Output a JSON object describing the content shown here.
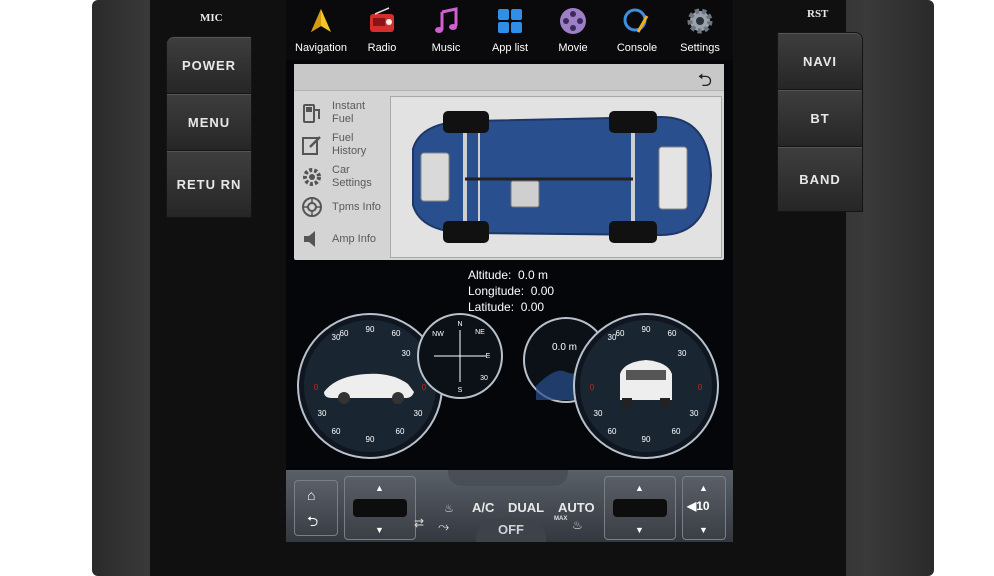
{
  "hardware": {
    "mic_label": "MIC",
    "rst_label": "RST",
    "left_buttons": [
      "POWER",
      "MENU",
      "RETU RN"
    ],
    "right_buttons": [
      "NAVI",
      "BT",
      "BAND"
    ]
  },
  "nav": {
    "items": [
      {
        "label": "Navigation",
        "icon": "navigation-icon"
      },
      {
        "label": "Radio",
        "icon": "radio-icon"
      },
      {
        "label": "Music",
        "icon": "music-icon"
      },
      {
        "label": "App list",
        "icon": "app-list-icon"
      },
      {
        "label": "Movie",
        "icon": "movie-icon"
      },
      {
        "label": "Console",
        "icon": "console-icon"
      },
      {
        "label": "Settings",
        "icon": "settings-icon"
      }
    ]
  },
  "menu": {
    "items": [
      {
        "label1": "Instant",
        "label2": "Fuel",
        "icon": "fuel-pump-icon"
      },
      {
        "label1": "Fuel",
        "label2": "History",
        "icon": "edit-note-icon"
      },
      {
        "label1": "Car",
        "label2": "Settings",
        "icon": "gear-icon"
      },
      {
        "label1": "Tpms Info",
        "label2": "",
        "icon": "tire-icon"
      },
      {
        "label1": "Amp Info",
        "label2": "",
        "icon": "speaker-icon"
      }
    ]
  },
  "location": {
    "altitude_label": "Altitude:",
    "altitude_value": "0.0 m",
    "longitude_label": "Longitude:",
    "longitude_value": "0.00",
    "latitude_label": "Latitude:",
    "latitude_value": "0.00"
  },
  "gauges": {
    "roll_ticks": [
      "30",
      "60",
      "90",
      "60",
      "30",
      "0",
      "0",
      "30",
      "60",
      "90",
      "60",
      "30"
    ],
    "compass": {
      "n": "N",
      "e": "E",
      "s": "S",
      "ne": "NE",
      "nw": "NW",
      "deg": "30"
    },
    "altimeter": "0.0 m",
    "pitch_ticks": [
      "30",
      "60",
      "90",
      "60",
      "30",
      "0",
      "0",
      "30",
      "60",
      "90",
      "60",
      "30"
    ]
  },
  "climate": {
    "ac": "A/C",
    "dual": "DUAL",
    "auto": "AUTO",
    "off": "OFF",
    "max": "MAX",
    "volume": "10"
  },
  "colors": {
    "accent_blue": "#2a4f8f",
    "gauge_red": "#d22020"
  }
}
